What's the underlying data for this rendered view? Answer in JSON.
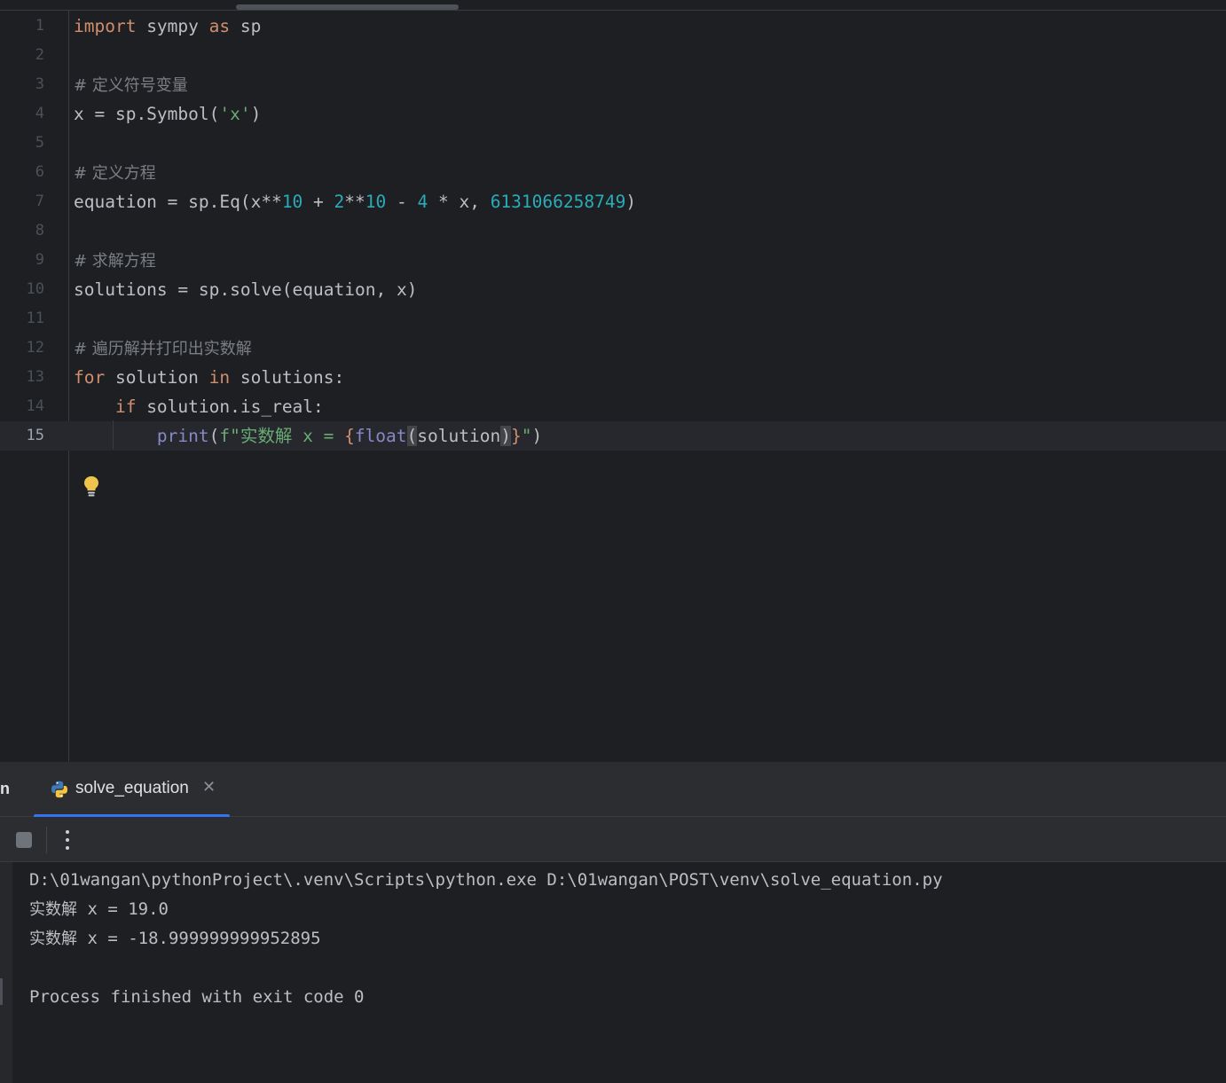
{
  "editor": {
    "lines": [
      {
        "n": "1",
        "tokens": [
          {
            "t": "import",
            "c": "kw"
          },
          {
            "t": " sympy "
          },
          {
            "t": "as",
            "c": "kw"
          },
          {
            "t": " sp"
          }
        ]
      },
      {
        "n": "2",
        "tokens": []
      },
      {
        "n": "3",
        "tokens": [
          {
            "t": "# 定义符号变量",
            "c": "cmt"
          }
        ]
      },
      {
        "n": "4",
        "tokens": [
          {
            "t": "x = sp.Symbol("
          },
          {
            "t": "'x'",
            "c": "str"
          },
          {
            "t": ")"
          }
        ]
      },
      {
        "n": "5",
        "tokens": []
      },
      {
        "n": "6",
        "tokens": [
          {
            "t": "# 定义方程",
            "c": "cmt"
          }
        ]
      },
      {
        "n": "7",
        "tokens": [
          {
            "t": "equation = sp.Eq(x**"
          },
          {
            "t": "10",
            "c": "num"
          },
          {
            "t": " + "
          },
          {
            "t": "2",
            "c": "num"
          },
          {
            "t": "**"
          },
          {
            "t": "10",
            "c": "num"
          },
          {
            "t": " - "
          },
          {
            "t": "4",
            "c": "num"
          },
          {
            "t": " * x, "
          },
          {
            "t": "6131066258749",
            "c": "num"
          },
          {
            "t": ")"
          }
        ]
      },
      {
        "n": "8",
        "tokens": []
      },
      {
        "n": "9",
        "tokens": [
          {
            "t": "# 求解方程",
            "c": "cmt"
          }
        ]
      },
      {
        "n": "10",
        "tokens": [
          {
            "t": "solutions = sp.solve(equation, x)"
          }
        ]
      },
      {
        "n": "11",
        "tokens": []
      },
      {
        "n": "12",
        "tokens": [
          {
            "t": "# 遍历解并打印出实数解",
            "c": "cmt"
          }
        ]
      },
      {
        "n": "13",
        "tokens": [
          {
            "t": "for",
            "c": "kw"
          },
          {
            "t": " solution "
          },
          {
            "t": "in",
            "c": "kw"
          },
          {
            "t": " solutions:"
          }
        ]
      },
      {
        "n": "14",
        "tokens": [
          {
            "t": "    "
          },
          {
            "t": "if",
            "c": "kw"
          },
          {
            "t": " solution.is_real:"
          }
        ]
      },
      {
        "n": "15",
        "current": true,
        "tokens": [
          {
            "t": "        "
          },
          {
            "t": "print",
            "c": "bi"
          },
          {
            "t": "("
          },
          {
            "t": "f\"实数解 x = ",
            "c": "str"
          },
          {
            "t": "{",
            "c": "brace"
          },
          {
            "t": "float",
            "c": "bi"
          },
          {
            "t": "(",
            "c": "match"
          },
          {
            "t": "solution"
          },
          {
            "t": ")",
            "c": "match"
          },
          {
            "t": "}",
            "c": "brace"
          },
          {
            "t": "\"",
            "c": "str"
          },
          {
            "t": ")"
          }
        ]
      }
    ]
  },
  "run_panel": {
    "panel_label": "n",
    "tab_label": "solve_equation",
    "close_symbol": "✕",
    "accent": "#3574f0"
  },
  "console": {
    "command": "D:\\01wangan\\pythonProject\\.venv\\Scripts\\python.exe D:\\01wangan\\POST\\venv\\solve_equation.py",
    "result_prefix": "实数解",
    "results": [
      " x = 19.0",
      " x = -18.999999999952895"
    ],
    "exit_message": "Process finished with exit code 0"
  }
}
